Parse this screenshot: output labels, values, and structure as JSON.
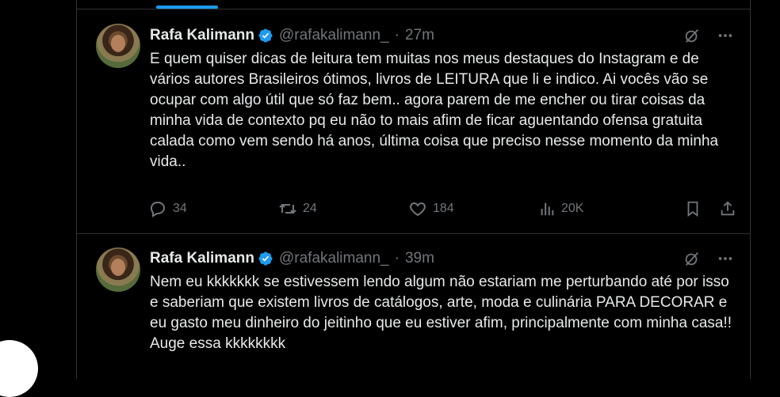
{
  "tweets": [
    {
      "author": "Rafa Kalimann",
      "handle": "@rafakalimann_",
      "separator": "·",
      "time": "27m",
      "text": "E quem quiser dicas de leitura tem muitas nos meus destaques do Instagram e de vários autores Brasileiros ótimos, livros de LEITURA que li e indico. Ai vocês vão se ocupar com algo útil que só faz bem.. agora parem de me encher ou tirar coisas da minha vida de contexto pq eu não to mais afim de ficar aguentando ofensa gratuita calada como vem sendo há anos, última coisa que preciso nesse momento da minha vida..",
      "replies": "34",
      "retweets": "24",
      "likes": "184",
      "views": "20K"
    },
    {
      "author": "Rafa Kalimann",
      "handle": "@rafakalimann_",
      "separator": "·",
      "time": "39m",
      "text": "Nem eu kkkkkkk se estivessem lendo algum não estariam me perturbando até por isso e saberiam que existem livros de catálogos, arte, moda e culinária PARA DECORAR e eu gasto meu dinheiro do jeitinho que eu estiver afim, principalmente com minha casa!! Auge essa kkkkkkkk"
    }
  ],
  "icons": {
    "verified": "verified-badge-icon",
    "grok": "grok-icon",
    "more": "more-icon",
    "reply": "reply-icon",
    "retweet": "retweet-icon",
    "like": "like-icon",
    "views": "views-icon",
    "bookmark": "bookmark-icon",
    "share": "share-icon"
  },
  "colors": {
    "background": "#000000",
    "text": "#e7e9ea",
    "secondary": "#71767b",
    "accent": "#1d9bf0",
    "divider": "#2f3336"
  }
}
